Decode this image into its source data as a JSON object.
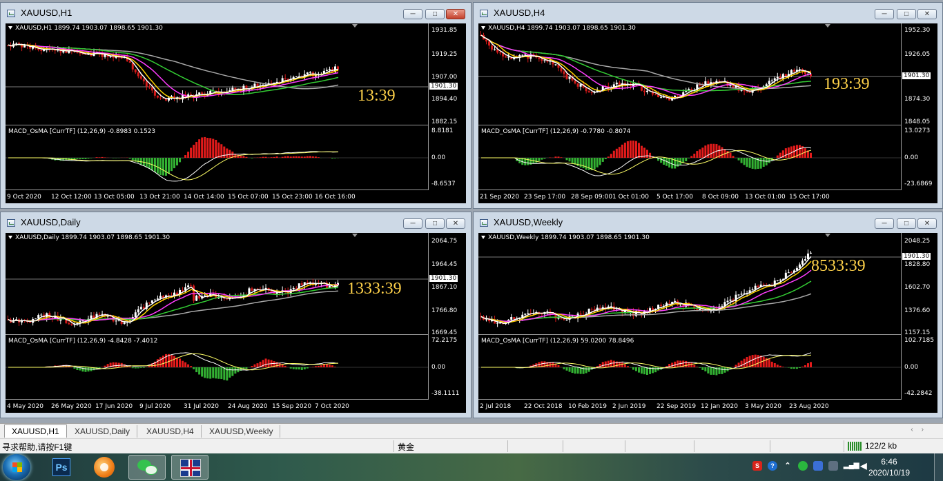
{
  "windows": [
    {
      "id": "h1",
      "title": "XAUUSD,H1",
      "header": "XAUUSD,H1  1899.74 1903.07 1898.65 1901.30",
      "price_ticks": [
        "1931.85",
        "1919.25",
        "1907.00",
        "1894.40",
        "1882.15"
      ],
      "current_price": "1901.30",
      "macd_label": "MACD_OsMA [CurrTF] (12,26,9) -0.8983 0.1523",
      "macd_ticks": [
        "8.8181",
        "0.00",
        "-8.6537"
      ],
      "dates": [
        "9 Oct 2020",
        "12 Oct 12:00",
        "13 Oct 05:00",
        "13 Oct 21:00",
        "14 Oct 14:00",
        "15 Oct 07:00",
        "15 Oct 23:00",
        "16 Oct 16:00"
      ],
      "countdown": "13:39"
    },
    {
      "id": "h4",
      "title": "XAUUSD,H4",
      "header": "XAUUSD,H4  1899.74 1903.07 1898.65 1901.30",
      "price_ticks": [
        "1952.30",
        "1926.05",
        "1901.30",
        "1874.30",
        "1848.05"
      ],
      "current_price": "1901.30",
      "macd_label": "MACD_OsMA [CurrTF] (12,26,9) -0.7780 -0.8074",
      "macd_ticks": [
        "13.0273",
        "0.00",
        "-23.6869"
      ],
      "dates": [
        "21 Sep 2020",
        "23 Sep 17:00",
        "28 Sep 09:00",
        "1 Oct 01:00",
        "5 Oct 17:00",
        "8 Oct 09:00",
        "13 Oct 01:00",
        "15 Oct 17:00"
      ],
      "countdown": "193:39"
    },
    {
      "id": "daily",
      "title": "XAUUSD,Daily",
      "header": "XAUUSD,Daily  1899.74 1903.07 1898.65 1901.30",
      "price_ticks": [
        "2064.75",
        "1964.45",
        "1867.10",
        "1766.80",
        "1669.45"
      ],
      "current_price": "1901.30",
      "macd_label": "MACD_OsMA [CurrTF] (12,26,9) -4.8428 -7.4012",
      "macd_ticks": [
        "72.2175",
        "0.00",
        "-38.1111"
      ],
      "dates": [
        "4 May 2020",
        "26 May 2020",
        "17 Jun 2020",
        "9 Jul 2020",
        "31 Jul 2020",
        "24 Aug 2020",
        "15 Sep 2020",
        "7 Oct 2020"
      ],
      "countdown": "1333:39"
    },
    {
      "id": "weekly",
      "title": "XAUUSD,Weekly",
      "header": "XAUUSD,Weekly  1899.74 1903.07 1898.65 1901.30",
      "price_ticks": [
        "2048.25",
        "1901.30",
        "1828.80",
        "1602.70",
        "1376.60",
        "1157.15"
      ],
      "current_price": "1901.30",
      "macd_label": "MACD_OsMA [CurrTF] (12,26,9) 59.0200 78.8496",
      "macd_ticks": [
        "102.7185",
        "0.00",
        "-42.2842"
      ],
      "dates": [
        "2 Jul 2018",
        "22 Oct 2018",
        "10 Feb 2019",
        "2 Jun 2019",
        "22 Sep 2019",
        "12 Jan 2020",
        "3 May 2020",
        "23 Aug 2020"
      ],
      "countdown": "8533:39"
    }
  ],
  "tabs": [
    "XAUUSD,H1",
    "XAUUSD,Daily",
    "XAUUSD,H4",
    "XAUUSD,Weekly"
  ],
  "status": {
    "help": "寻求帮助,请按F1键",
    "profile": "黄金",
    "traffic": "122/2 kb"
  },
  "taskbar": {
    "time": "6:46",
    "date": "2020/10/19",
    "ps_label": "Ps"
  },
  "colors": {
    "candle_up": "#ffffff",
    "candle_down": "#d61a1a",
    "ma_white": "#ffffff",
    "ma_yellow": "#ffd400",
    "ma_magenta": "#ff3cff",
    "ma_green": "#33cc33",
    "ma_gray": "#a8a8a8",
    "hist_up": "#e41b1b",
    "hist_down": "#33b233",
    "countdown": "#ffd24a"
  },
  "window_controls": {
    "minimize": "minimize-icon",
    "maximize": "maximize-icon",
    "close": "close-icon"
  }
}
